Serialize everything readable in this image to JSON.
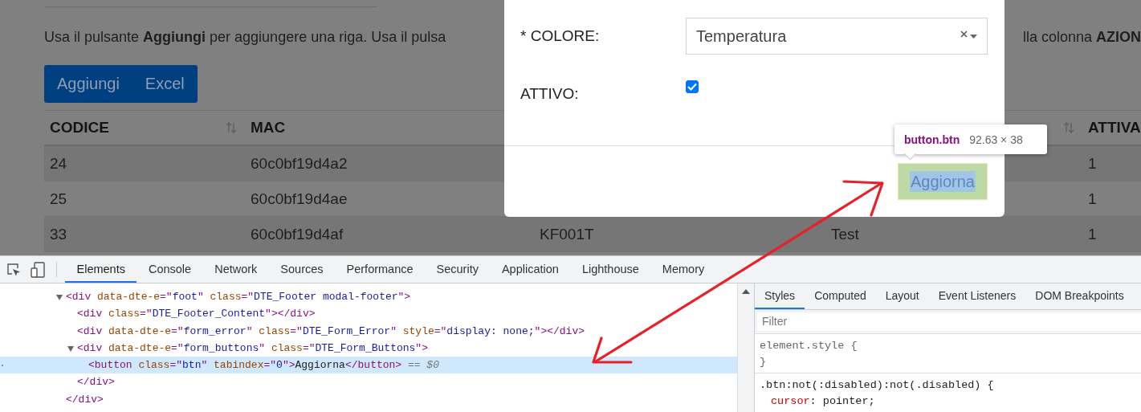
{
  "page": {
    "intro_text": "Usa il pulsante **Aggiungi** per aggiungere una riga. Usa il pulsa",
    "intro_text_end": "lla colonna **AZION**",
    "buttons": [
      "Aggiungi",
      "Excel"
    ],
    "table": {
      "headers": {
        "column_1": {
          "label": "CODICE",
          "sort_icon": true
        },
        "column_2": {
          "label": "MAC"
        },
        "column_4": {
          "sort_icon": true
        },
        "column_5": {
          "label": "ATTIVA"
        }
      },
      "rows": [
        {
          "column_1": "24",
          "column_2": "60c0bf19d4a2",
          "column_5": "1"
        },
        {
          "column_1": "25",
          "column_2": "60c0bf19d4ae",
          "column_5": "1"
        },
        {
          "column_1": "33",
          "column_2": "60c0bf19d4af",
          "column_3": "KF001T",
          "column_4": "Test",
          "column_5": "1"
        }
      ]
    }
  },
  "modal": {
    "fields": [
      {
        "kind": "select",
        "label": "* COLORE:",
        "value": "Temperatura"
      },
      {
        "kind": "checkbox",
        "label": "ATTIVO:",
        "checked": true
      }
    ],
    "footer_button": "Aggiorna",
    "inspect_tooltip": {
      "selector": "button.btn",
      "size": "92.63 × 38"
    }
  },
  "devtools": {
    "tabs": [
      {
        "label": "Elements",
        "selected": true
      },
      {
        "label": "Console",
        "selected": false
      },
      {
        "label": "Network",
        "selected": false
      },
      {
        "label": "Sources",
        "selected": false
      },
      {
        "label": "Performance",
        "selected": false
      },
      {
        "label": "Security",
        "selected": false
      },
      {
        "label": "Application",
        "selected": false
      },
      {
        "label": "Lighthouse",
        "selected": false
      },
      {
        "label": "Memory",
        "selected": false
      }
    ],
    "elements": [
      {
        "expanded": true,
        "selected": false,
        "open": [
          {
            "kind": "tag",
            "text": "<div"
          },
          {
            "kind": "attr",
            "text": " data-dte-e"
          },
          {
            "kind": "tag",
            "text": "=\""
          },
          {
            "kind": "value",
            "text": "foot"
          },
          {
            "kind": "tag",
            "text": "\""
          },
          {
            "kind": "attr",
            "text": " class"
          },
          {
            "kind": "tag",
            "text": "=\""
          },
          {
            "kind": "value",
            "text": "DTE_Footer modal-footer"
          },
          {
            "kind": "tag",
            "text": "\">"
          }
        ],
        "close": [
          {
            "kind": "tag",
            "text": "</div>"
          }
        ],
        "children": [
          {
            "selected": false,
            "open": [
              {
                "kind": "tag",
                "text": "<div"
              },
              {
                "kind": "attr",
                "text": " class"
              },
              {
                "kind": "tag",
                "text": "=\""
              },
              {
                "kind": "value",
                "text": "DTE_Footer_Content"
              },
              {
                "kind": "tag",
                "text": "\"></div>"
              }
            ]
          },
          {
            "selected": false,
            "open": [
              {
                "kind": "tag",
                "text": "<div"
              },
              {
                "kind": "attr",
                "text": " data-dte-e"
              },
              {
                "kind": "tag",
                "text": "=\""
              },
              {
                "kind": "value",
                "text": "form_error"
              },
              {
                "kind": "tag",
                "text": "\""
              },
              {
                "kind": "attr",
                "text": " class"
              },
              {
                "kind": "tag",
                "text": "=\""
              },
              {
                "kind": "value",
                "text": "DTE_Form_Error"
              },
              {
                "kind": "tag",
                "text": "\""
              },
              {
                "kind": "attr",
                "text": " style"
              },
              {
                "kind": "tag",
                "text": "=\""
              },
              {
                "kind": "value",
                "text": "display: none;"
              },
              {
                "kind": "tag",
                "text": "\"></div>"
              }
            ]
          },
          {
            "expanded": true,
            "selected": false,
            "open": [
              {
                "kind": "tag",
                "text": "<div"
              },
              {
                "kind": "attr",
                "text": " data-dte-e"
              },
              {
                "kind": "tag",
                "text": "=\""
              },
              {
                "kind": "value",
                "text": "form_buttons"
              },
              {
                "kind": "tag",
                "text": "\""
              },
              {
                "kind": "attr",
                "text": " class"
              },
              {
                "kind": "tag",
                "text": "=\""
              },
              {
                "kind": "value",
                "text": "DTE_Form_Buttons"
              },
              {
                "kind": "tag",
                "text": "\">"
              }
            ],
            "close": [
              {
                "kind": "tag",
                "text": "</div>"
              }
            ],
            "children": [
              {
                "selected": true,
                "open": [
                  {
                    "kind": "tag",
                    "text": "<button"
                  },
                  {
                    "kind": "attr",
                    "text": " class"
                  },
                  {
                    "kind": "tag",
                    "text": "=\""
                  },
                  {
                    "kind": "value",
                    "text": "btn"
                  },
                  {
                    "kind": "tag",
                    "text": "\""
                  },
                  {
                    "kind": "attr",
                    "text": " tabindex"
                  },
                  {
                    "kind": "tag",
                    "text": "=\""
                  },
                  {
                    "kind": "value",
                    "text": "0"
                  },
                  {
                    "kind": "tag",
                    "text": "\">"
                  },
                  {
                    "kind": "content",
                    "text": "Aggiorna"
                  },
                  {
                    "kind": "tag",
                    "text": "</button>"
                  },
                  {
                    "kind": "note",
                    "text": " == $0"
                  }
                ]
              }
            ]
          }
        ]
      }
    ],
    "style_tabs": [
      {
        "label": "Styles",
        "selected": true
      },
      {
        "label": "Computed",
        "selected": false
      },
      {
        "label": "Layout",
        "selected": false
      },
      {
        "label": "Event Listeners",
        "selected": false
      },
      {
        "label": "DOM Breakpoints",
        "selected": false
      }
    ],
    "filter": {
      "placeholder": "Filter"
    },
    "rules": [
      {
        "kind": "inline",
        "selector": "element.style {",
        "close": "}"
      },
      {
        "kind": "matched",
        "selector": ".btn:not(:disabled):not(.disabled) {",
        "declarations": [
          {
            "property": "cursor",
            "rest": ": pointer;"
          }
        ]
      }
    ]
  }
}
